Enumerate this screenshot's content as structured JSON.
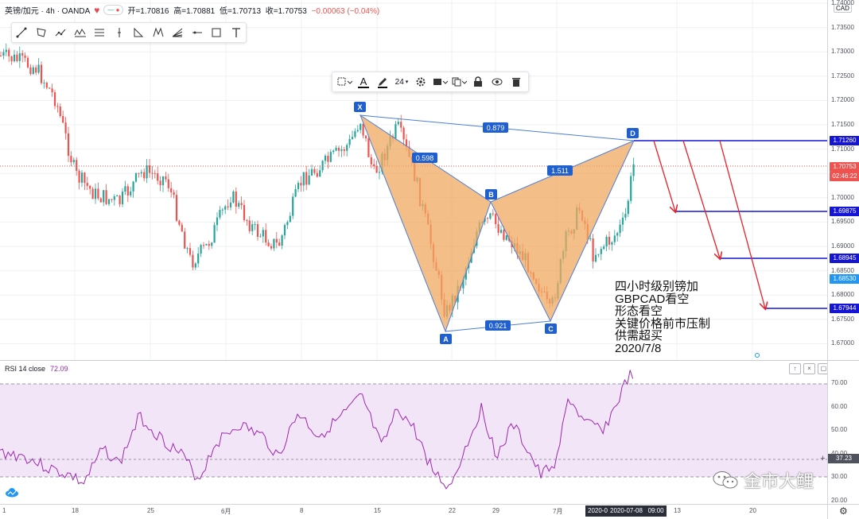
{
  "header": {
    "symbol": "英镑/加元 · 4h · OANDA",
    "open_label": "开=1.70816",
    "high_label": "高=1.70881",
    "low_label": "低=1.70713",
    "close_label": "收=1.70753",
    "change": "−0.00063 (−0.04%)",
    "pill_dash": "—",
    "pill_dot": "●"
  },
  "currency": "CAD",
  "drawing_tools": [
    "trend-line-icon",
    "rectangle-icon",
    "path-icon",
    "xabcd-pattern-icon",
    "parallel-channel-icon",
    "vertical-line-icon",
    "triangle-pattern-icon",
    "abcd-pattern-icon",
    "fib-fan-icon",
    "horizontal-ray-icon",
    "box-icon",
    "text-tool-icon"
  ],
  "format_toolbar": {
    "font_size": "24",
    "items": [
      "select-style-icon",
      "text-color-icon",
      "pencil-icon",
      "font-size-dropdown",
      "settings-icon",
      "fill-icon",
      "clone-icon",
      "lock-icon",
      "visibility-icon",
      "trash-icon"
    ]
  },
  "pattern": {
    "points": {
      "X": "X",
      "A": "A",
      "B": "B",
      "C": "C",
      "D": "D"
    },
    "ratios": {
      "xb": "0.598",
      "xd": "0.879",
      "ac": "0.921",
      "bd": "1.511"
    },
    "fill_color": "#f0a860",
    "line_color": "#4c7ed9"
  },
  "price_axis": {
    "ticks": [
      "1.74000",
      "1.73500",
      "1.73000",
      "1.72500",
      "1.72000",
      "1.71500",
      "1.71000",
      "1.70500",
      "1.70000",
      "1.69500",
      "1.69000",
      "1.68500",
      "1.68000",
      "1.67500",
      "1.67000"
    ],
    "labels": {
      "d_level": "1.71260",
      "last": "1.70753",
      "countdown": "02:46:22",
      "t1": "1.69875",
      "t2": "1.68945",
      "current_line": "1.68530",
      "t3": "1.67944"
    },
    "colors": {
      "level": "#1515d6",
      "last": "#ef5350",
      "current": "#2196f3"
    }
  },
  "annotation": {
    "lines": [
      "四小时级别镑加",
      "GBPCAD看空",
      "形态看空",
      "关键价格前市压制",
      "供需超买",
      "2020/7/8"
    ]
  },
  "rsi": {
    "title": "RSI 14 close",
    "value": "72.09",
    "ticks": [
      "70.00",
      "60.00",
      "50.00",
      "40.00",
      "30.00",
      "20.00"
    ],
    "level_label": "37.23",
    "line_color": "#9c27b0",
    "band_color": "#f3e5f8",
    "buttons": {
      "up": "↑",
      "close": "×",
      "maximize": "▢"
    }
  },
  "time_axis": {
    "labels": [
      {
        "text": "1"
      },
      {
        "text": "18"
      },
      {
        "text": "25"
      },
      {
        "text": "6月"
      },
      {
        "text": "8"
      },
      {
        "text": "15"
      },
      {
        "text": "22"
      },
      {
        "text": "29"
      },
      {
        "text": "7月"
      },
      {
        "text": "13"
      },
      {
        "text": "20"
      }
    ],
    "date_left": "2020-0",
    "date_right": "2020-07-08   09:00"
  },
  "watermark": "金市大鲤"
}
